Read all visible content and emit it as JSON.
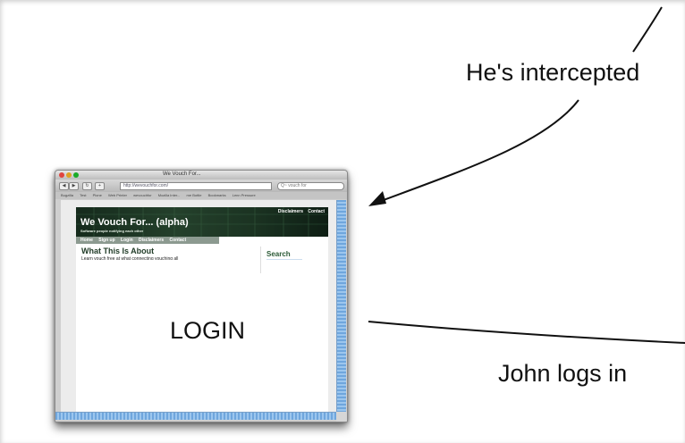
{
  "labels": {
    "intercepted": "He's intercepted",
    "john_logs_in": "John logs in",
    "login": "LOGIN"
  },
  "browser": {
    "window_title": "We Vouch For...",
    "url": "http://wevouchfor.com/",
    "search_placeholder": "Q~ vouch for",
    "bookmarks": [
      "Bugzilla",
      "Test",
      "Plone",
      "Web Printer",
      "wevouchfor",
      "Mozilla Inter...",
      "me Bottle",
      "Bookmarks",
      "Lenn Pressure"
    ],
    "back_button": "◀",
    "forward_button": "▶",
    "reload_button": "↻",
    "add_button": "+"
  },
  "site": {
    "title": "We Vouch For... (alpha)",
    "subtitle": "Software people notifying each other",
    "top_links": [
      "Disclaimers",
      "Contact"
    ],
    "nav": [
      "Home",
      "Sign up",
      "Login",
      "Disclaimers",
      "Contact"
    ],
    "content_heading": "What This Is About",
    "content_text": "Learn vouch free at what connecting vouching all",
    "sidebar_heading": "Search"
  },
  "colors": {
    "arrow": "#111111",
    "banner": "#1b3322",
    "scrollbar": "#6fa6dd"
  }
}
